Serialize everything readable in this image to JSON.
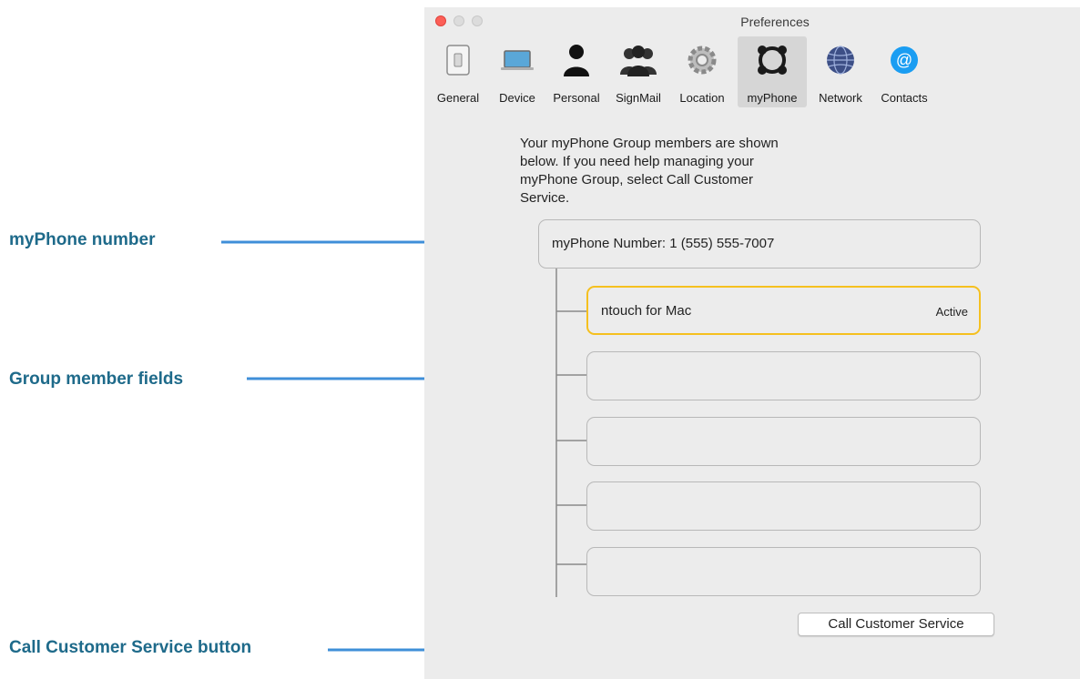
{
  "callouts": {
    "phone_number": "myPhone number",
    "members": "Group member fields",
    "button": "Call Customer Service button"
  },
  "window": {
    "title": "Preferences"
  },
  "toolbar": {
    "tabs": [
      {
        "label": "General",
        "icon": "general-icon"
      },
      {
        "label": "Device",
        "icon": "device-icon"
      },
      {
        "label": "Personal",
        "icon": "personal-icon"
      },
      {
        "label": "SignMail",
        "icon": "signmail-icon"
      },
      {
        "label": "Location",
        "icon": "location-icon"
      },
      {
        "label": "myPhone",
        "icon": "myphone-icon",
        "selected": true
      },
      {
        "label": "Network",
        "icon": "network-icon"
      },
      {
        "label": "Contacts",
        "icon": "contacts-icon"
      }
    ]
  },
  "content": {
    "intro": "Your myPhone Group members are shown below. If you need help managing your myPhone Group, select Call Customer Service.",
    "number_field": "myPhone Number: 1 (555) 555-7007",
    "members": [
      {
        "name": "ntouch for Mac",
        "status": "Active"
      },
      {
        "name": "",
        "status": ""
      },
      {
        "name": "",
        "status": ""
      },
      {
        "name": "",
        "status": ""
      },
      {
        "name": "",
        "status": ""
      }
    ],
    "button_label": "Call Customer Service"
  },
  "colors": {
    "callout_text": "#1e6a8a",
    "arrow": "#3f8fd8",
    "active_border": "#f5c01f"
  }
}
